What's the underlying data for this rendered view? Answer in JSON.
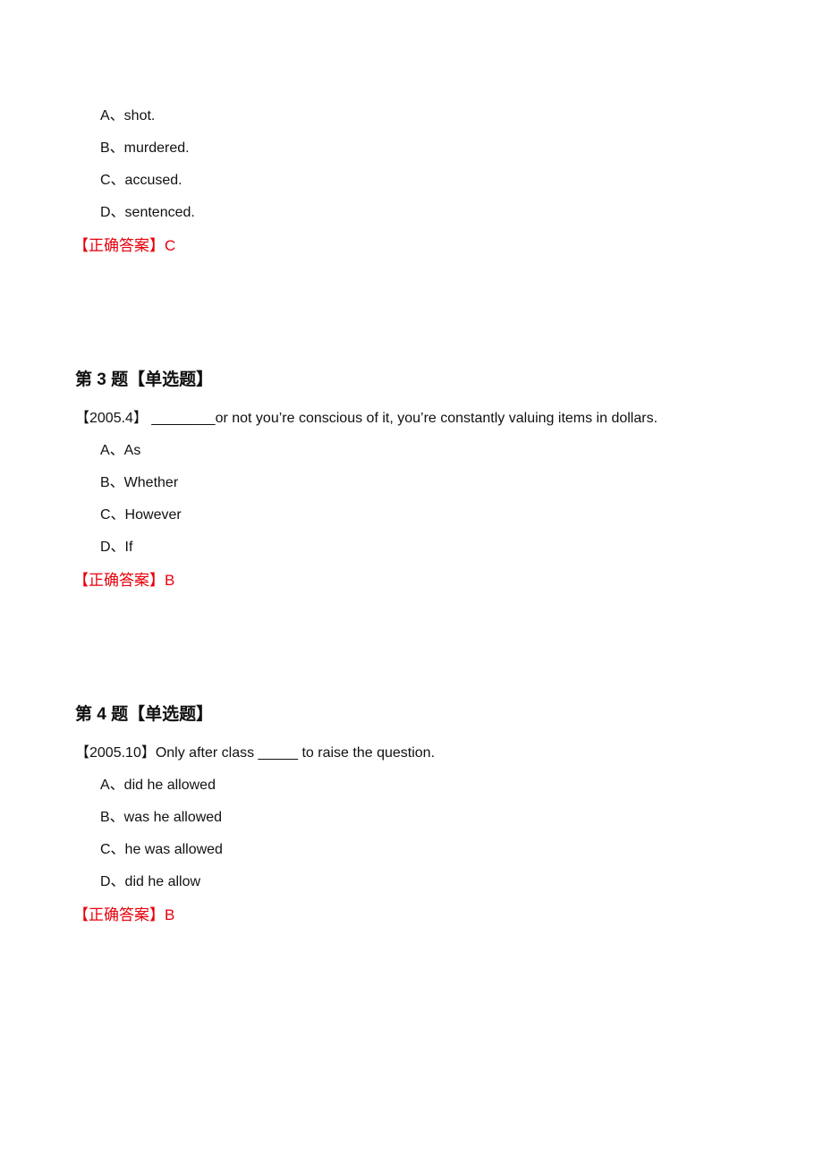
{
  "blocks": [
    {
      "options": [
        "A、shot.",
        "B、murdered.",
        "C、accused.",
        "D、sentenced."
      ],
      "answer": "【正确答案】C"
    },
    {
      "heading": "第 3 题【单选题】",
      "question": "【2005.4】 ________or not you’re conscious of it, you’re constantly valuing items in dollars.",
      "options": [
        "A、As",
        "B、Whether",
        "C、However",
        "D、If"
      ],
      "answer": "【正确答案】B"
    },
    {
      "heading": "第 4 题【单选题】",
      "question": "【2005.10】Only after class _____ to raise the question.",
      "options": [
        "A、did he allowed",
        "B、was he allowed",
        "C、he was allowed",
        "D、did he allow"
      ],
      "answer": "【正确答案】B"
    }
  ]
}
